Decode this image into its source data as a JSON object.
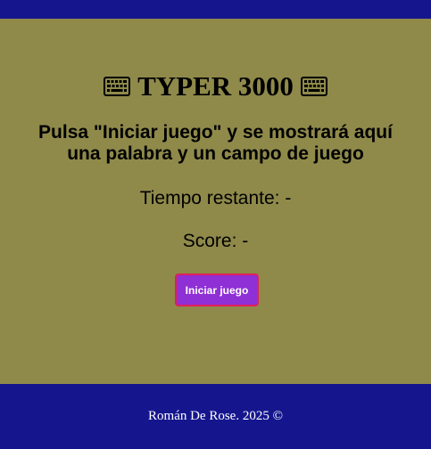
{
  "colors": {
    "background": "#8f8a4a",
    "bar": "#15168e",
    "button_bg": "#8f2fd6",
    "button_border": "#e0205a",
    "footer_text": "#ffffff"
  },
  "header": {
    "title": "TYPER 3000",
    "left_icon": "keyboard-icon",
    "right_icon": "keyboard-icon"
  },
  "game": {
    "instructions": "Pulsa \"Iniciar juego\" y se mostrará aquí una palabra y un campo de juego",
    "timer_text": "Tiempo restante: -",
    "score_text": "Score: -",
    "start_label": "Iniciar juego"
  },
  "footer": {
    "text": "Román De Rose. 2025 ©"
  }
}
